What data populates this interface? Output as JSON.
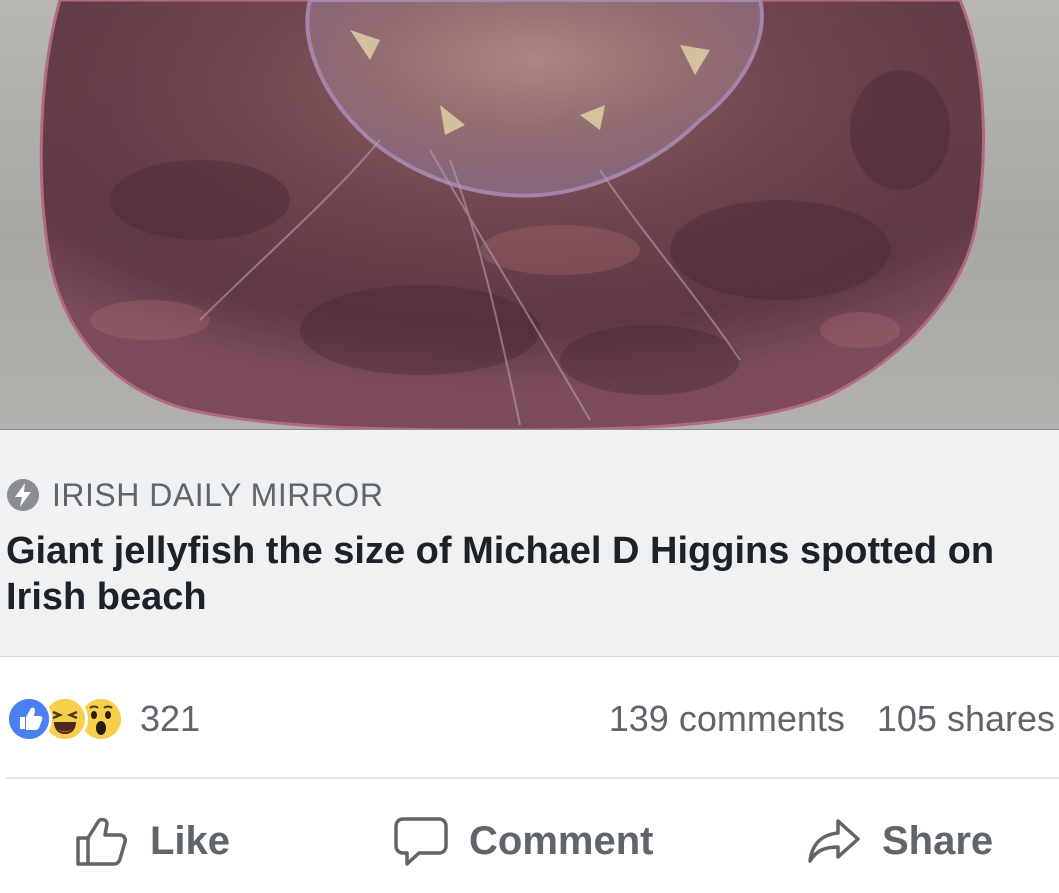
{
  "photo": {
    "subject": "jellyfish-photo"
  },
  "link_preview": {
    "source_icon": "lightning-bolt-icon",
    "source": "IRISH DAILY MIRROR",
    "headline": "Giant jellyfish the size of Michael D Higgins spotted on Irish beach"
  },
  "stats": {
    "reactions": [
      "like",
      "haha",
      "wow"
    ],
    "reaction_count": "321",
    "comments": "139 comments",
    "shares": "105 shares"
  },
  "actions": {
    "like_label": "Like",
    "comment_label": "Comment",
    "share_label": "Share"
  },
  "colors": {
    "like_blue": "#4a80f0",
    "reaction_yellow": "#f7cf4a",
    "muted_text": "#60646b",
    "headline_text": "#1d2129",
    "link_background": "#f0f1f3"
  }
}
